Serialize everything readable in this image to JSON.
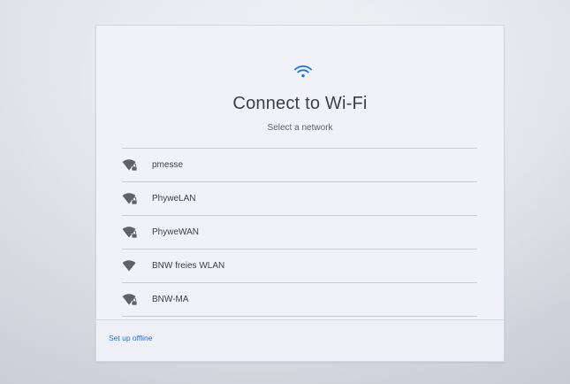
{
  "colors": {
    "accent": "#1a73e8",
    "text_primary": "#3c4045",
    "icon_gray": "#5f6368"
  },
  "header": {
    "icon": "wifi-icon",
    "title": "Connect to Wi-Fi",
    "subtitle": "Select a network"
  },
  "networks": [
    {
      "name": "pmesse",
      "icon": "wifi-lock-icon",
      "secured": true
    },
    {
      "name": "PhyweLAN",
      "icon": "wifi-lock-icon",
      "secured": true
    },
    {
      "name": "PhyweWAN",
      "icon": "wifi-lock-icon",
      "secured": true
    },
    {
      "name": "BNW freies WLAN",
      "icon": "wifi-icon",
      "secured": false
    },
    {
      "name": "BNW-MA",
      "icon": "wifi-lock-icon",
      "secured": true
    }
  ],
  "footer": {
    "offline_label": "Set up offline"
  }
}
